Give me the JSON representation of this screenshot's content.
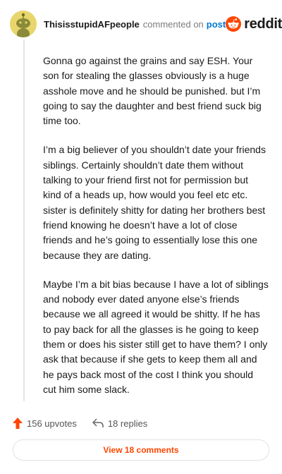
{
  "header": {
    "username": "ThisisstupidAFpeople",
    "action_text": "commented on",
    "post_link": "post",
    "brand": "reddit"
  },
  "comment": {
    "paragraphs": [
      "Gonna go against the grains and say ESH. Your son for stealing the glasses obviously is a huge asshole move and he should be punished. but I’m going to say the daughter and best friend suck big time too.",
      "I’m a big believer of you shouldn’t date your friends siblings. Certainly shouldn’t date them without talking to your friend first not for permission but kind of a heads up, how would you feel etc etc. sister is definitely shitty for dating her brothers best friend knowing he doesn’t have a lot of close friends and he’s going to essentially lose this one because they are dating.",
      "Maybe I’m a bit bias because I have a lot of siblings and nobody ever dated anyone else’s friends because we all agreed it would be shitty. If he has to pay back for all the glasses is he going to keep them or does his sister still get to have them? I only ask that because if she gets to keep them all and he pays back most of the cost I think you should cut him some slack."
    ]
  },
  "footer": {
    "upvotes": "156 upvotes",
    "replies": "18 replies",
    "view_button": "View 18 comments"
  },
  "colors": {
    "accent": "#ff4500",
    "link": "#0079d3"
  }
}
